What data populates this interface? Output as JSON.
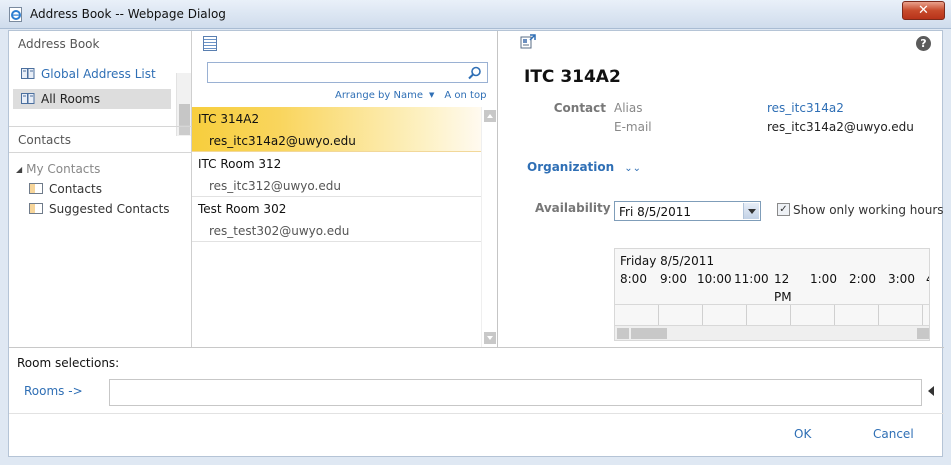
{
  "window": {
    "title": "Address Book -- Webpage Dialog",
    "close_label": "✕"
  },
  "sidebar": {
    "address_book_title": "Address Book",
    "items": [
      {
        "label": "Global Address List",
        "icon": "book-icon",
        "selected": false
      },
      {
        "label": "All Rooms",
        "icon": "book-icon",
        "selected": true
      }
    ],
    "contacts_title": "Contacts",
    "tree_root": "My Contacts",
    "tree_children": [
      "Contacts",
      "Suggested Contacts"
    ]
  },
  "list": {
    "search": {
      "value": "",
      "placeholder": ""
    },
    "arrange_label": "Arrange by Name",
    "order_label": "A on top",
    "rows": [
      {
        "name": "ITC 314A2",
        "email": "res_itc314a2@uwyo.edu",
        "selected": true
      },
      {
        "name": "ITC Room 312",
        "email": "res_itc312@uwyo.edu",
        "selected": false
      },
      {
        "name": "Test Room 302",
        "email": "res_test302@uwyo.edu",
        "selected": false
      }
    ]
  },
  "details": {
    "title": "ITC 314A2",
    "contact_label": "Contact",
    "alias_key": "Alias",
    "alias_value": "res_itc314a2",
    "email_key": "E-mail",
    "email_value": "res_itc314a2@uwyo.edu",
    "organization_label": "Organization",
    "availability_label": "Availability",
    "date_value": "Fri 8/5/2011",
    "show_working_hours_label": "Show only working hours",
    "show_working_hours_checked": true,
    "schedule_day": "Friday 8/5/2011",
    "hours": [
      "8:00",
      "9:00",
      "10:00",
      "11:00",
      "12",
      "1:00",
      "2:00",
      "3:00",
      "4"
    ],
    "pm_label": "PM"
  },
  "bottom": {
    "room_selections_label": "Room selections:",
    "rooms_button": "Rooms ->",
    "rooms_field_value": "",
    "ok_label": "OK",
    "cancel_label": "Cancel"
  },
  "colors": {
    "link": "#2f6fb5",
    "selection": "#f7ce3d",
    "titlebar": "#cfdcec"
  }
}
